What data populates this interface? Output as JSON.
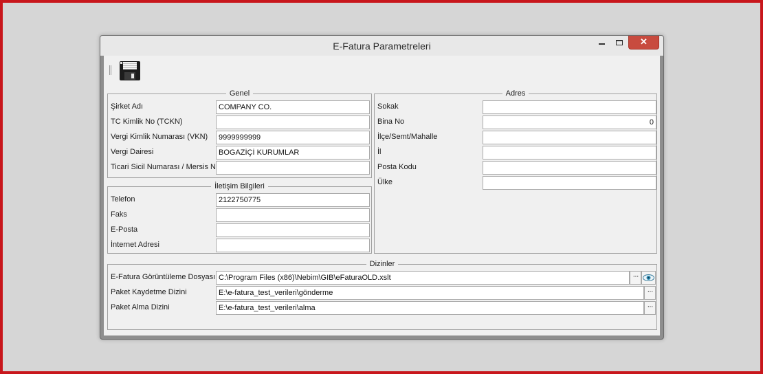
{
  "window": {
    "title": "E-Fatura Parametreleri"
  },
  "titlebar_icons": {
    "minimize": "minimize-icon",
    "maximize": "maximize-icon",
    "close": "close-icon"
  },
  "toolbar": {
    "save_icon": "floppy-disk-save-icon"
  },
  "colors": {
    "frame_border": "#c8161c",
    "close_button": "#c84b3f",
    "window_chrome": "#8e8e8e",
    "client_bg": "#f0f0f0"
  },
  "genel": {
    "title": "Genel",
    "fields": [
      {
        "label": "Şirket Adı",
        "value": "COMPANY CO."
      },
      {
        "label": "TC Kimlik No (TCKN)",
        "value": ""
      },
      {
        "label": "Vergi Kimlik Numarası (VKN)",
        "value": "9999999999"
      },
      {
        "label": "Vergi Dairesi",
        "value": "BOGAZİÇİ KURUMLAR"
      },
      {
        "label": "Ticari Sicil Numarası / Mersis No",
        "value": ""
      }
    ]
  },
  "iletisim": {
    "title": "İletişim Bilgileri",
    "fields": [
      {
        "label": "Telefon",
        "value": "2122750775"
      },
      {
        "label": "Faks",
        "value": ""
      },
      {
        "label": "E-Posta",
        "value": ""
      },
      {
        "label": "İnternet Adresi",
        "value": ""
      }
    ]
  },
  "adres": {
    "title": "Adres",
    "fields": [
      {
        "label": "Sokak",
        "value": ""
      },
      {
        "label": "Bina No",
        "value": "0"
      },
      {
        "label": "İlçe/Semt/Mahalle",
        "value": ""
      },
      {
        "label": "İl",
        "value": ""
      },
      {
        "label": "Posta Kodu",
        "value": ""
      },
      {
        "label": "Ülke",
        "value": ""
      }
    ]
  },
  "dizinler": {
    "title": "Dizinler",
    "fields": [
      {
        "label": "E-Fatura Görüntüleme Dosyası",
        "value": "C:\\Program Files (x86)\\Nebim\\GIB\\eFaturaOLD.xslt"
      },
      {
        "label": "Paket Kaydetme Dizini",
        "value": "E:\\e-fatura_test_verileri\\gönderme"
      },
      {
        "label": "Paket Alma Dizini",
        "value": "E:\\e-fatura_test_verileri\\alma"
      }
    ],
    "browse_label": "···"
  }
}
